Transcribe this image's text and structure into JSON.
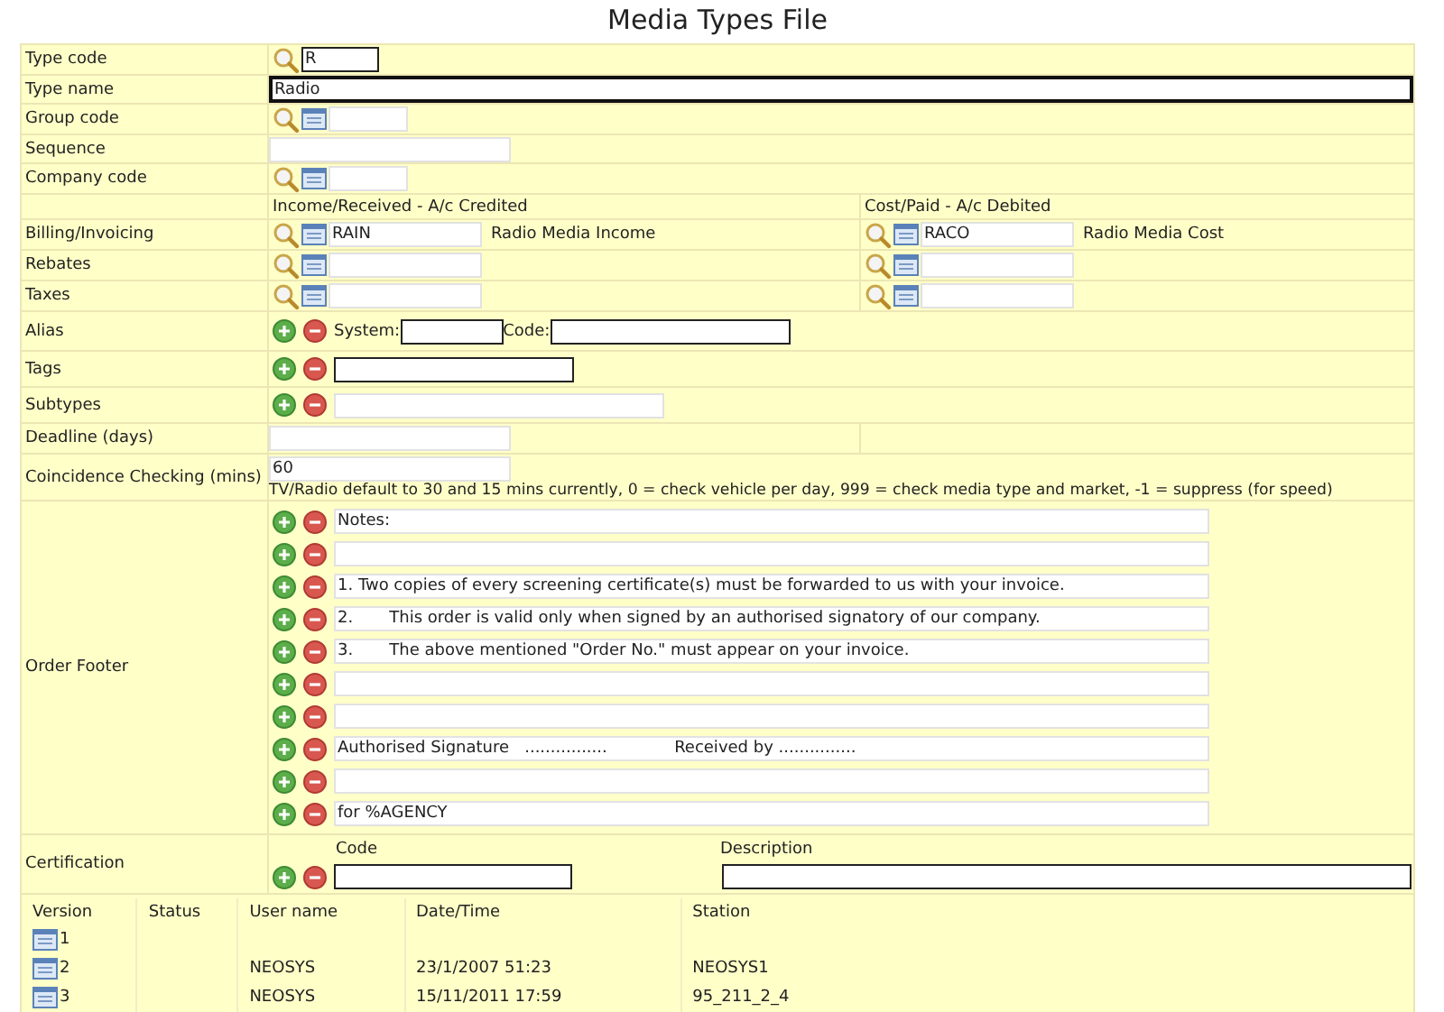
{
  "title": "Media Types File",
  "type_code": {
    "label": "Type code",
    "value": "R",
    "required": true
  },
  "type_name": {
    "label": "Type name",
    "value": "Radio",
    "focused": true
  },
  "group_code": {
    "label": "Group code",
    "required": false
  },
  "sequence": {
    "label": "Sequence",
    "required": false
  },
  "company_code": {
    "label": "Company code",
    "required": false
  },
  "account_headers": [
    "Income/Received - A/c Credited",
    "Cost/Paid - A/c Debited"
  ],
  "accounts": [
    {
      "label": "Billing/Invoicing",
      "income": {
        "code": "RAIN",
        "name": "Radio Media Income"
      },
      "cost": {
        "code": "RACO",
        "name": "Radio Media Cost"
      }
    },
    {
      "label": "Rebates"
    },
    {
      "label": "Taxes"
    }
  ],
  "alias": {
    "label": "Alias",
    "system_label": "System:",
    "code_label": "Code:",
    "required": true
  },
  "tags": {
    "label": "Tags",
    "required": true
  },
  "subtypes": {
    "label": "Subtypes",
    "required": false
  },
  "deadline": {
    "label": "Deadline (days)",
    "required": false
  },
  "coincidence": {
    "label": "Coincidence Checking (mins)",
    "value": "60",
    "note": "TV/Radio default to 30 and 15 mins currently, 0 = check vehicle per day, 999 = check media type and market, -1 = suppress (for speed)"
  },
  "order_footer": {
    "label": "Order Footer",
    "lines": [
      {
        "kind": "text",
        "value": "Notes:"
      },
      {
        "kind": "blank"
      },
      {
        "kind": "text",
        "value": "1. Two copies of every screening certificate(s) must be forwarded to us with your invoice."
      },
      {
        "kind": "text",
        "value": "2.       This order is valid only when signed by an authorised signatory of our company."
      },
      {
        "kind": "text",
        "value": "3.       The above mentioned \"Order No.\" must appear on your invoice."
      },
      {
        "kind": "blank"
      },
      {
        "kind": "blank"
      },
      {
        "kind": "text",
        "value": "Authorised Signature   ................             Received by ..............."
      },
      {
        "kind": "blank"
      },
      {
        "kind": "text",
        "value": "for %AGENCY"
      }
    ]
  },
  "certification": {
    "label": "Certification",
    "columns": [
      "Code",
      "Description"
    ],
    "required": true
  },
  "versions": {
    "columns": [
      "Version",
      "Status",
      "User name",
      "Date/Time",
      "Station"
    ],
    "rows": [
      {
        "version": "1"
      },
      {
        "version": "2",
        "user": "NEOSYS",
        "datetime": "23/1/2007 51:23",
        "station": "NEOSYS1"
      },
      {
        "version": "3",
        "user": "NEOSYS",
        "datetime": "15/11/2011 17:59",
        "station": "95_211_2_4"
      }
    ]
  }
}
